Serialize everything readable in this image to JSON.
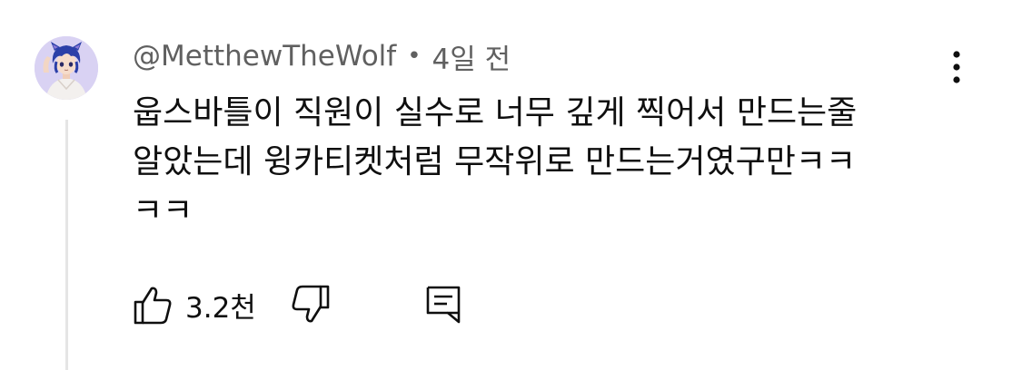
{
  "comment": {
    "author": "@MetthewTheWolf",
    "separator": "•",
    "time": "4일 전",
    "text_lines": [
      "웁스바틀이 직원이 실수로 너무 깊게 찍어서 만드는줄",
      "알았는데 윙카티켓처럼 무작위로 만드는거였구만ㅋㅋ",
      "ㅋㅋ"
    ],
    "like_count": "3.2천"
  },
  "icons": {
    "avatar": "anime-wolf-avatar",
    "more": "vertical-dots-icon",
    "like": "thumbs-up-icon",
    "dislike": "thumbs-down-icon",
    "reply": "comment-icon"
  },
  "colors": {
    "text_primary": "#0f0f0f",
    "text_secondary": "#606060",
    "thread_line": "#e5e5e5",
    "avatar_bg": "#d9d2f3"
  }
}
